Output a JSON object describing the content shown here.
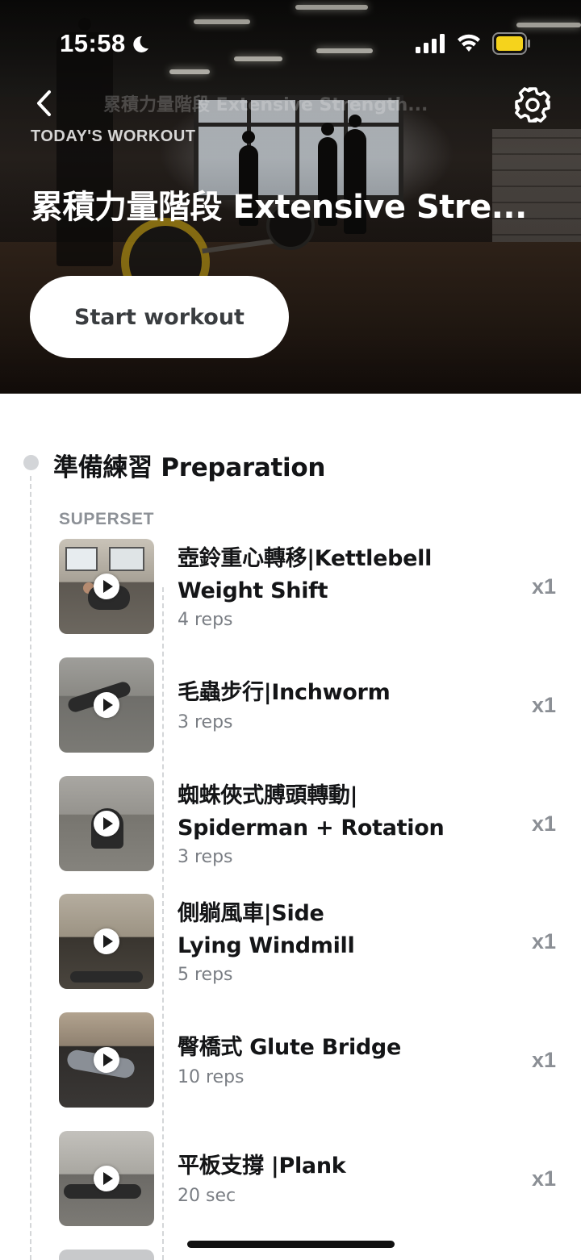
{
  "status_bar": {
    "time": "15:58",
    "icons": [
      "moon-icon",
      "cellular-signal-icon",
      "wifi-icon",
      "battery-icon"
    ],
    "battery_color": "#F5D31C"
  },
  "header": {
    "back_icon": "chevron-left-icon",
    "settings_icon": "gear-icon",
    "ghost_title": "累積力量階段 Extensive Strength...",
    "label": "TODAY'S WORKOUT",
    "title": "累積力量階段 Extensive Stre...",
    "start_button": "Start workout"
  },
  "section": {
    "title": "準備練習 Preparation",
    "group_label": "SUPERSET"
  },
  "exercises": [
    {
      "name_line1": "壺鈴重心轉移|Kettlebell",
      "name_line2": "Weight Shift",
      "detail": "4 reps",
      "multiplier": "x1"
    },
    {
      "name_line1": "毛蟲步行|Inchworm",
      "name_line2": "",
      "detail": "3 reps",
      "multiplier": "x1"
    },
    {
      "name_line1": "蜘蛛俠式膊頭轉動|",
      "name_line2": "Spiderman + Rotation",
      "detail": "3 reps",
      "multiplier": "x1"
    },
    {
      "name_line1": "側躺風車|Side",
      "name_line2": "Lying Windmill",
      "detail": "5 reps",
      "multiplier": "x1"
    },
    {
      "name_line1": "臀橋式 Glute Bridge",
      "name_line2": "",
      "detail": "10 reps",
      "multiplier": "x1"
    },
    {
      "name_line1": "平板支撐 |Plank",
      "name_line2": "",
      "detail": "20 sec",
      "multiplier": "x1"
    }
  ],
  "colors": {
    "accent_button_bg": "#FFFFFF",
    "timeline": "#D4D6D8",
    "muted_text": "#8B8F95"
  }
}
